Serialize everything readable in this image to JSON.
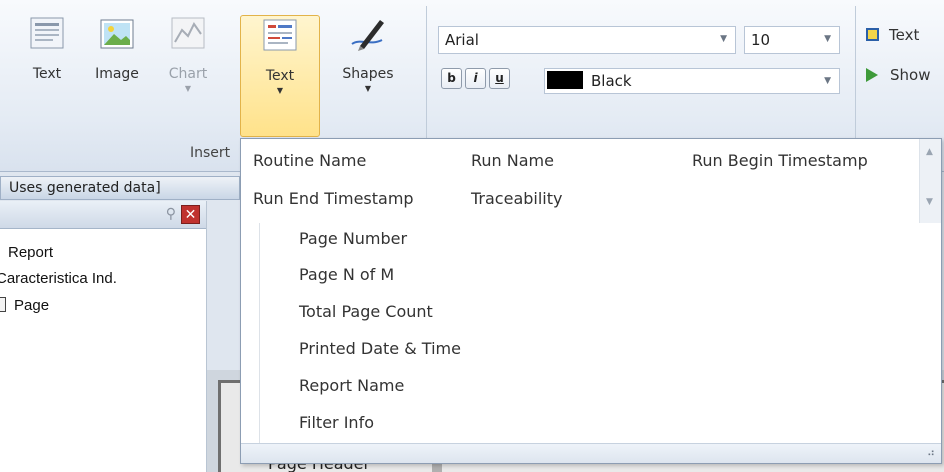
{
  "ribbon": {
    "insert_group": {
      "label": "Insert",
      "buttons": [
        {
          "label": "Text"
        },
        {
          "label": "Image"
        },
        {
          "label": "Chart"
        },
        {
          "label": "Text"
        },
        {
          "label": "Shapes"
        }
      ]
    },
    "font": {
      "family": "Arial",
      "size": "10",
      "bold": "b",
      "italic": "i",
      "underline": "u",
      "color": "Black",
      "color_hex": "#000000"
    },
    "side": {
      "item1": "Text",
      "item2": "Show"
    }
  },
  "data_bar": {
    "title": "Uses generated data]"
  },
  "tree": {
    "items": [
      "Report",
      "Caracteristica Ind.",
      "Page"
    ]
  },
  "canvas": {
    "page_header": "Page Header"
  },
  "dropdown": {
    "top_items": [
      "Routine Name",
      "Run Name",
      "Run Begin Timestamp",
      "Run End Timestamp",
      "Traceability"
    ],
    "sub_items": [
      "Page Number",
      "Page N of M",
      "Total Page Count",
      "Printed Date & Time",
      "Report Name",
      "Filter Info"
    ]
  },
  "colors": {
    "selected_button": "#ffe28a",
    "ribbon_bg": "#e4ebf4",
    "close_button": "#c0322f"
  },
  "icons": [
    "text-icon",
    "image-icon",
    "chart-icon",
    "text-field-icon",
    "shapes-pen-icon",
    "pin-icon",
    "close-icon",
    "text-box-icon",
    "show-arrow-icon",
    "resize-grip-icon"
  ]
}
